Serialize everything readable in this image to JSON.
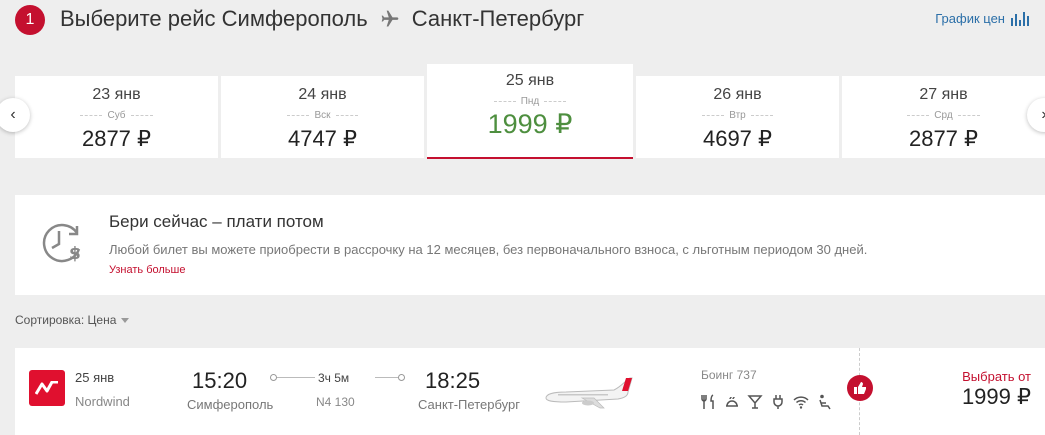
{
  "header": {
    "step": "1",
    "title_prefix": "Выберите рейс Симферополь",
    "title_dest": "Санкт-Петербург",
    "price_graph_label": "График цен"
  },
  "dates": [
    {
      "date": "23 янв",
      "dow": "Суб",
      "price": "2877 ₽"
    },
    {
      "date": "24 янв",
      "dow": "Вск",
      "price": "4747 ₽"
    },
    {
      "date": "25 янв",
      "dow": "Пнд",
      "price": "1999 ₽",
      "selected": true
    },
    {
      "date": "26 янв",
      "dow": "Втр",
      "price": "4697 ₽"
    },
    {
      "date": "27 янв",
      "dow": "Срд",
      "price": "2877 ₽"
    }
  ],
  "promo": {
    "title": "Бери сейчас – плати потом",
    "text": "Любой билет вы можете приобрести в рассрочку на 12 месяцев, без первоначального взноса, с льготным периодом 30 дней.",
    "link": "Узнать больше"
  },
  "sort": {
    "label": "Сортировка: Цена"
  },
  "flight": {
    "date": "25 янв",
    "airline": "Nordwind",
    "dep_time": "15:20",
    "dep_city": "Симферополь",
    "duration": "3ч 5м",
    "flight_no": "N4 130",
    "arr_time": "18:25",
    "arr_city": "Санкт-Петербург",
    "aircraft": "Боинг 737",
    "amenities": [
      "meal-icon",
      "hot-meal-icon",
      "drinks-icon",
      "power-outlet-icon",
      "wifi-icon",
      "seat-icon"
    ],
    "select_label": "Выбрать от",
    "price": "1999 ₽"
  },
  "colors": {
    "brand": "#c4102f",
    "selected_price": "#4e8f3f",
    "link": "#2b6fa8"
  }
}
